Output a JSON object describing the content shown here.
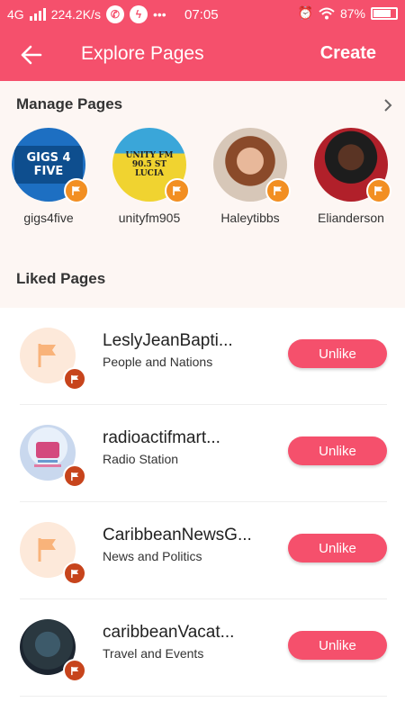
{
  "status_bar": {
    "network": "4G",
    "speed": "224.2K/s",
    "time": "07:05",
    "battery": "87%"
  },
  "header": {
    "title": "Explore Pages",
    "create_label": "Create"
  },
  "manage": {
    "title": "Manage Pages",
    "pages": [
      {
        "name": "gigs4five",
        "logo_text": "GIGS 4 FIVE"
      },
      {
        "name": "unityfm905",
        "logo_text": "UNITY FM 90.5 ST LUCIA"
      },
      {
        "name": "Haleytibbs"
      },
      {
        "name": "Elianderson"
      }
    ]
  },
  "liked": {
    "title": "Liked Pages",
    "items": [
      {
        "name": "LeslyJeanBapti...",
        "category": "People and Nations",
        "action": "Unlike"
      },
      {
        "name": "radioactifmart...",
        "category": "Radio Station",
        "action": "Unlike"
      },
      {
        "name": "CaribbeanNewsG...",
        "category": "News and Politics",
        "action": "Unlike"
      },
      {
        "name": "caribbeanVacat...",
        "category": "Travel and Events",
        "action": "Unlike"
      }
    ]
  },
  "colors": {
    "accent": "#f5506c",
    "badge_orange": "#f28f22",
    "badge_dark": "#c7441c"
  }
}
